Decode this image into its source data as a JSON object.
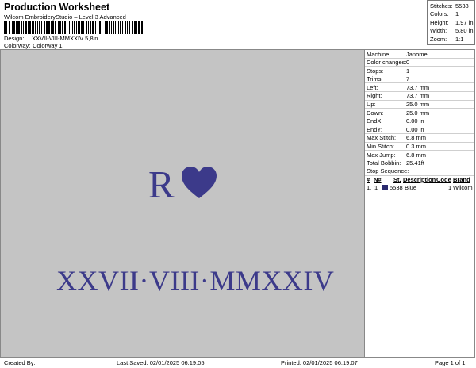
{
  "header": {
    "title": "Production Worksheet",
    "subtitle": "Wilcom EmbroideryStudio – Level 3 Advanced",
    "design_label": "Design:",
    "design_value": "XXVII-VIII-MMXXIV 5,8in",
    "colorway_label": "Colorway:",
    "colorway_value": "Colorway 1"
  },
  "summary": [
    {
      "label": "Stitches:",
      "value": "5538"
    },
    {
      "label": "Colors:",
      "value": "1"
    },
    {
      "label": "Height:",
      "value": "1.97 in"
    },
    {
      "label": "Width:",
      "value": "5.80 in"
    },
    {
      "label": "Zoom:",
      "value": "1:1"
    }
  ],
  "design": {
    "line1": "R",
    "heart_icon": "heart-icon",
    "line2": "XXVII·VIII·MMXXIV",
    "thread_color": "#3c3a8a",
    "background_color": "#c4c4c4"
  },
  "details": [
    {
      "label": "Machine:",
      "value": "Janome"
    },
    {
      "label": "Color changes:",
      "value": "0"
    },
    {
      "label": "Stops:",
      "value": "1"
    },
    {
      "label": "Trims:",
      "value": "7"
    },
    {
      "label": "Left:",
      "value": "73.7 mm"
    },
    {
      "label": "Right:",
      "value": "73.7 mm"
    },
    {
      "label": "Up:",
      "value": "25.0 mm"
    },
    {
      "label": "Down:",
      "value": "25.0 mm"
    },
    {
      "label": "EndX:",
      "value": "0.00 in"
    },
    {
      "label": "EndY:",
      "value": "0.00 in"
    },
    {
      "label": "Max Stitch:",
      "value": "6.8 mm"
    },
    {
      "label": "Min Stitch:",
      "value": "0.3 mm"
    },
    {
      "label": "Max Jump:",
      "value": "6.8 mm"
    },
    {
      "label": "Total Bobbin:",
      "value": "25.41ft"
    }
  ],
  "stop_sequence": {
    "title": "Stop Sequence:",
    "headers": [
      "#",
      "N#",
      "St.",
      "Description",
      "Code",
      "Brand"
    ],
    "rows": [
      {
        "num": "1.",
        "n": "1",
        "st": "5538",
        "description": "Blue",
        "code": "1",
        "brand": "Wilcom",
        "swatch_color": "#2a2a6e"
      }
    ]
  },
  "footer": {
    "created": "Created By:",
    "last_saved": "Last Saved: 02/01/2025 06.19.05",
    "printed": "Printed: 02/01/2025 06.19.07",
    "page": "Page 1 of 1"
  }
}
